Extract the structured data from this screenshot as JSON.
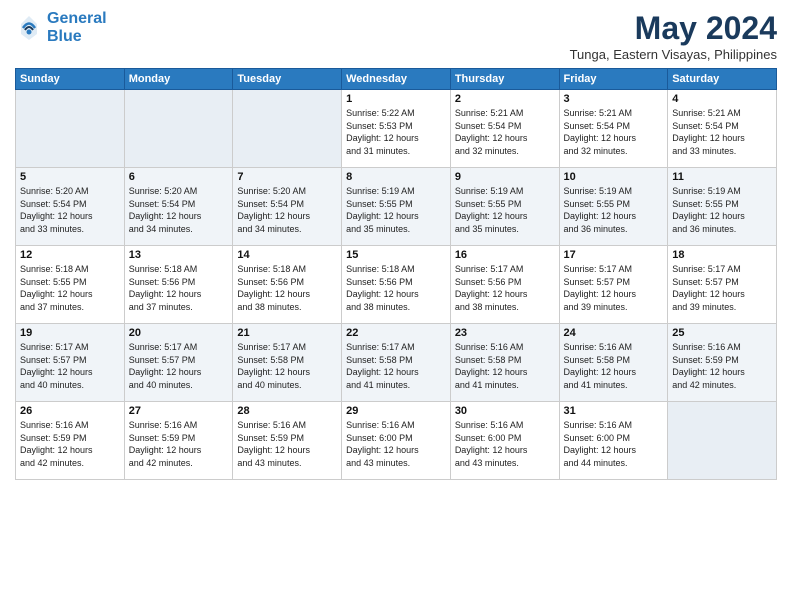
{
  "logo": {
    "line1": "General",
    "line2": "Blue"
  },
  "title": "May 2024",
  "location": "Tunga, Eastern Visayas, Philippines",
  "weekdays": [
    "Sunday",
    "Monday",
    "Tuesday",
    "Wednesday",
    "Thursday",
    "Friday",
    "Saturday"
  ],
  "weeks": [
    [
      {
        "day": "",
        "data": ""
      },
      {
        "day": "",
        "data": ""
      },
      {
        "day": "",
        "data": ""
      },
      {
        "day": "1",
        "data": "Sunrise: 5:22 AM\nSunset: 5:53 PM\nDaylight: 12 hours\nand 31 minutes."
      },
      {
        "day": "2",
        "data": "Sunrise: 5:21 AM\nSunset: 5:54 PM\nDaylight: 12 hours\nand 32 minutes."
      },
      {
        "day": "3",
        "data": "Sunrise: 5:21 AM\nSunset: 5:54 PM\nDaylight: 12 hours\nand 32 minutes."
      },
      {
        "day": "4",
        "data": "Sunrise: 5:21 AM\nSunset: 5:54 PM\nDaylight: 12 hours\nand 33 minutes."
      }
    ],
    [
      {
        "day": "5",
        "data": "Sunrise: 5:20 AM\nSunset: 5:54 PM\nDaylight: 12 hours\nand 33 minutes."
      },
      {
        "day": "6",
        "data": "Sunrise: 5:20 AM\nSunset: 5:54 PM\nDaylight: 12 hours\nand 34 minutes."
      },
      {
        "day": "7",
        "data": "Sunrise: 5:20 AM\nSunset: 5:54 PM\nDaylight: 12 hours\nand 34 minutes."
      },
      {
        "day": "8",
        "data": "Sunrise: 5:19 AM\nSunset: 5:55 PM\nDaylight: 12 hours\nand 35 minutes."
      },
      {
        "day": "9",
        "data": "Sunrise: 5:19 AM\nSunset: 5:55 PM\nDaylight: 12 hours\nand 35 minutes."
      },
      {
        "day": "10",
        "data": "Sunrise: 5:19 AM\nSunset: 5:55 PM\nDaylight: 12 hours\nand 36 minutes."
      },
      {
        "day": "11",
        "data": "Sunrise: 5:19 AM\nSunset: 5:55 PM\nDaylight: 12 hours\nand 36 minutes."
      }
    ],
    [
      {
        "day": "12",
        "data": "Sunrise: 5:18 AM\nSunset: 5:55 PM\nDaylight: 12 hours\nand 37 minutes."
      },
      {
        "day": "13",
        "data": "Sunrise: 5:18 AM\nSunset: 5:56 PM\nDaylight: 12 hours\nand 37 minutes."
      },
      {
        "day": "14",
        "data": "Sunrise: 5:18 AM\nSunset: 5:56 PM\nDaylight: 12 hours\nand 38 minutes."
      },
      {
        "day": "15",
        "data": "Sunrise: 5:18 AM\nSunset: 5:56 PM\nDaylight: 12 hours\nand 38 minutes."
      },
      {
        "day": "16",
        "data": "Sunrise: 5:17 AM\nSunset: 5:56 PM\nDaylight: 12 hours\nand 38 minutes."
      },
      {
        "day": "17",
        "data": "Sunrise: 5:17 AM\nSunset: 5:57 PM\nDaylight: 12 hours\nand 39 minutes."
      },
      {
        "day": "18",
        "data": "Sunrise: 5:17 AM\nSunset: 5:57 PM\nDaylight: 12 hours\nand 39 minutes."
      }
    ],
    [
      {
        "day": "19",
        "data": "Sunrise: 5:17 AM\nSunset: 5:57 PM\nDaylight: 12 hours\nand 40 minutes."
      },
      {
        "day": "20",
        "data": "Sunrise: 5:17 AM\nSunset: 5:57 PM\nDaylight: 12 hours\nand 40 minutes."
      },
      {
        "day": "21",
        "data": "Sunrise: 5:17 AM\nSunset: 5:58 PM\nDaylight: 12 hours\nand 40 minutes."
      },
      {
        "day": "22",
        "data": "Sunrise: 5:17 AM\nSunset: 5:58 PM\nDaylight: 12 hours\nand 41 minutes."
      },
      {
        "day": "23",
        "data": "Sunrise: 5:16 AM\nSunset: 5:58 PM\nDaylight: 12 hours\nand 41 minutes."
      },
      {
        "day": "24",
        "data": "Sunrise: 5:16 AM\nSunset: 5:58 PM\nDaylight: 12 hours\nand 41 minutes."
      },
      {
        "day": "25",
        "data": "Sunrise: 5:16 AM\nSunset: 5:59 PM\nDaylight: 12 hours\nand 42 minutes."
      }
    ],
    [
      {
        "day": "26",
        "data": "Sunrise: 5:16 AM\nSunset: 5:59 PM\nDaylight: 12 hours\nand 42 minutes."
      },
      {
        "day": "27",
        "data": "Sunrise: 5:16 AM\nSunset: 5:59 PM\nDaylight: 12 hours\nand 42 minutes."
      },
      {
        "day": "28",
        "data": "Sunrise: 5:16 AM\nSunset: 5:59 PM\nDaylight: 12 hours\nand 43 minutes."
      },
      {
        "day": "29",
        "data": "Sunrise: 5:16 AM\nSunset: 6:00 PM\nDaylight: 12 hours\nand 43 minutes."
      },
      {
        "day": "30",
        "data": "Sunrise: 5:16 AM\nSunset: 6:00 PM\nDaylight: 12 hours\nand 43 minutes."
      },
      {
        "day": "31",
        "data": "Sunrise: 5:16 AM\nSunset: 6:00 PM\nDaylight: 12 hours\nand 44 minutes."
      },
      {
        "day": "",
        "data": ""
      }
    ]
  ]
}
